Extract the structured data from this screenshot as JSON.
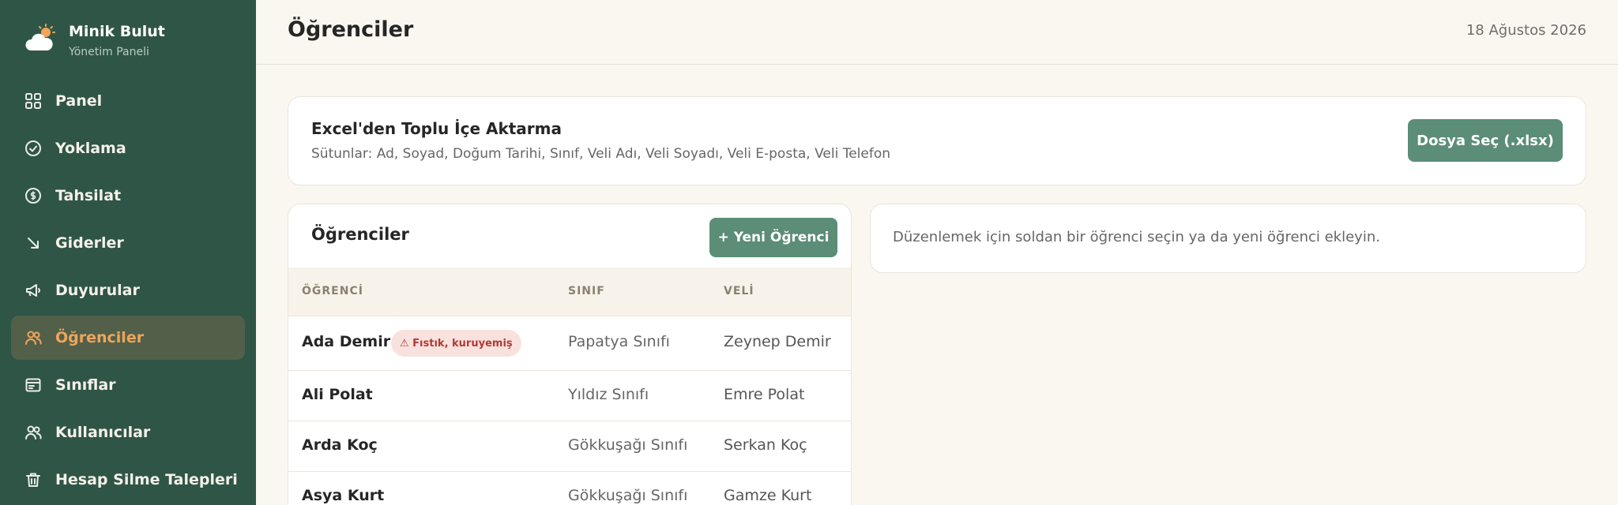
{
  "brand": {
    "name": "Minik Bulut",
    "subtitle": "Yönetim Paneli"
  },
  "sidebar": {
    "items": [
      {
        "label": "Panel",
        "icon": "grid-icon",
        "active": false
      },
      {
        "label": "Yoklama",
        "icon": "check-circle-icon",
        "active": false
      },
      {
        "label": "Tahsilat",
        "icon": "coin-icon",
        "active": false
      },
      {
        "label": "Giderler",
        "icon": "arrow-down-right-icon",
        "active": false
      },
      {
        "label": "Duyurular",
        "icon": "megaphone-icon",
        "active": false
      },
      {
        "label": "Öğrenciler",
        "icon": "users-icon",
        "active": true
      },
      {
        "label": "Sınıflar",
        "icon": "class-icon",
        "active": false
      },
      {
        "label": "Kullanıcılar",
        "icon": "users-icon",
        "active": false
      },
      {
        "label": "Hesap Silme Talepleri",
        "icon": "trash-icon",
        "active": false
      }
    ]
  },
  "header": {
    "title": "Öğrenciler",
    "date": "18 Ağustos 2026"
  },
  "import": {
    "title": "Excel'den Toplu İçe Aktarma",
    "columns": "Sütunlar: Ad, Soyad, Doğum Tarihi, Sınıf, Veli Adı, Veli Soyadı, Veli E-posta, Veli Telefon",
    "button": "Dosya Seç (.xlsx)"
  },
  "students": {
    "title": "Öğrenciler",
    "new_button": "+ Yeni Öğrenci",
    "columns": [
      "ÖĞRENCİ",
      "SINIF",
      "VELİ"
    ],
    "rows": [
      {
        "name": "Ada Demir",
        "allergy": "⚠ Fıstık, kuruyemiş",
        "class": "Papatya Sınıfı",
        "parent": "Zeynep Demir"
      },
      {
        "name": "Ali Polat",
        "allergy": "",
        "class": "Yıldız Sınıfı",
        "parent": "Emre Polat"
      },
      {
        "name": "Arda Koç",
        "allergy": "",
        "class": "Gökkuşağı Sınıfı",
        "parent": "Serkan Koç"
      },
      {
        "name": "Asya Kurt",
        "allergy": "",
        "class": "Gökkuşağı Sınıfı",
        "parent": "Gamze Kurt"
      }
    ]
  },
  "editor": {
    "placeholder": "Düzenlemek için soldan bir öğrenci seçin ya da yeni öğrenci ekleyin."
  },
  "colors": {
    "sidebar": "#2f5547",
    "accent": "#5b8d77",
    "active_text": "#f0a55a",
    "allergy_bg": "#f9e1de",
    "allergy_text": "#b03b33"
  }
}
